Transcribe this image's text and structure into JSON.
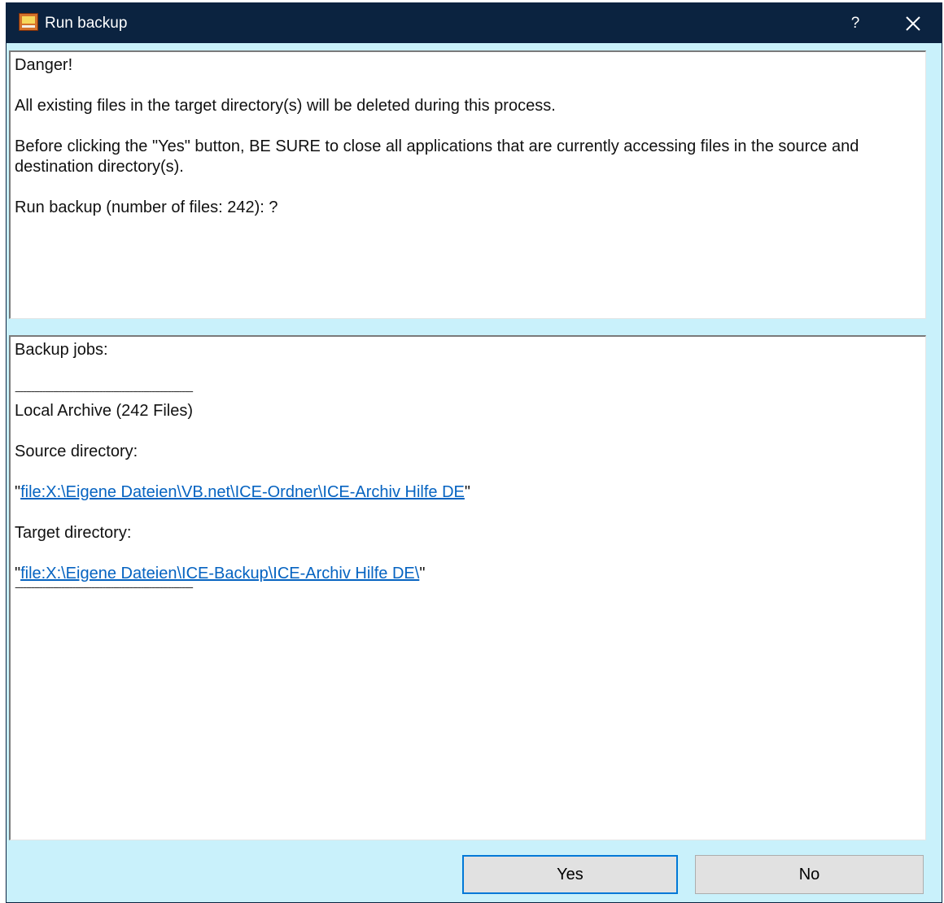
{
  "window": {
    "title": "Run backup",
    "help_label": "?",
    "close_icon": "close-icon",
    "app_icon": "backup-app-icon"
  },
  "message": {
    "heading": "Danger!",
    "line1": "All existing files in the target directory(s) will be deleted during this process.",
    "line2": "Before clicking the \"Yes\" button, BE SURE to close all applications that are currently accessing files in the source and destination directory(s).",
    "line3": "Run backup (number of files: 242): ?"
  },
  "jobs": {
    "heading": "Backup jobs:",
    "separator": "-----------------------------------------------------------------",
    "job_name": "Local Archive (242 Files)",
    "source_label": "Source directory:",
    "source_path": "file:X:\\Eigene Dateien\\VB.net\\ICE-Ordner\\ICE-Archiv Hilfe DE",
    "target_label": "Target directory:",
    "target_path": "file:X:\\Eigene Dateien\\ICE-Backup\\ICE-Archiv Hilfe DE\\",
    "quote": "\""
  },
  "buttons": {
    "yes": "Yes",
    "no": "No"
  },
  "colors": {
    "titlebar": "#0b2340",
    "window_bg": "#c9f1fb",
    "link": "#0563c1",
    "focus_border": "#0078d7"
  }
}
